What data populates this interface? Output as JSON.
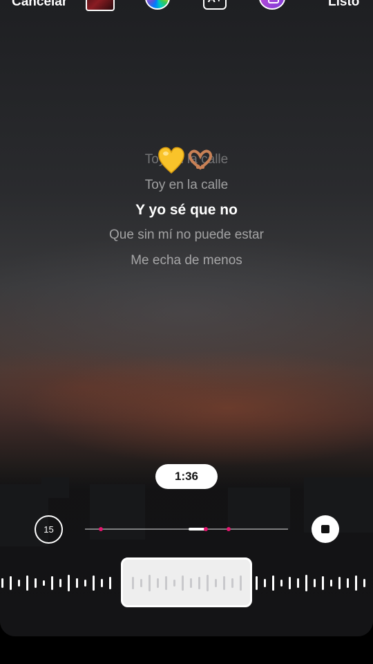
{
  "topbar": {
    "cancel_label": "Cancelar",
    "done_label": "Listo",
    "album_thumb_icon": "album-cover-thumbnail",
    "color_icon": "color-wheel-icon",
    "font_icon_label": "A+",
    "style_icon": "lyrics-style-icon"
  },
  "lyrics": {
    "lines": [
      {
        "text": "Toy en la calle",
        "state": "faded"
      },
      {
        "text": "Toy en la calle",
        "state": "dim"
      },
      {
        "text": "Y yo sé que no",
        "state": "current"
      },
      {
        "text": "Que sin mí no puede estar",
        "state": "dim"
      },
      {
        "text": "Me echa de menos",
        "state": "dim"
      }
    ],
    "emojis": [
      "yellow-heart",
      "heart-hands"
    ]
  },
  "player": {
    "time": "1:36",
    "duration_selector_label": "15",
    "stop_icon": "stop-icon"
  },
  "colors": {
    "accent": "#e5156f",
    "text_current": "#ffffff",
    "text_dim": "rgba(255,255,255,0.55)"
  }
}
